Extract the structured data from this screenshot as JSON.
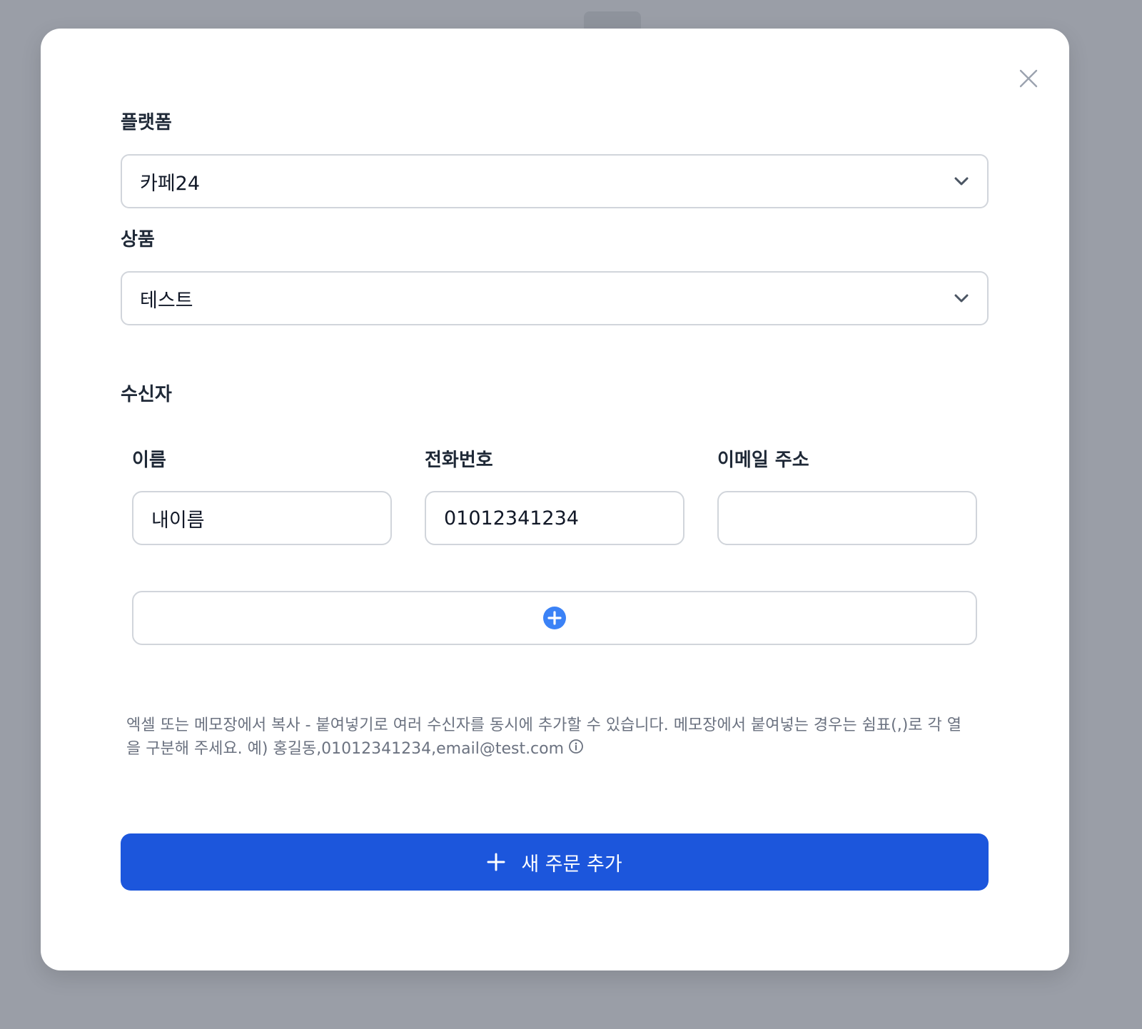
{
  "form": {
    "platform": {
      "label": "플랫폼",
      "value": "카페24"
    },
    "product": {
      "label": "상품",
      "value": "테스트"
    },
    "recipients": {
      "section_title": "수신자",
      "columns": {
        "name": "이름",
        "phone": "전화번호",
        "email": "이메일 주소"
      },
      "row": {
        "name": "내이름",
        "phone": "01012341234",
        "email": ""
      }
    },
    "help_text": "엑셀 또는 메모장에서 복사 - 붙여넣기로 여러 수신자를 동시에 추가할 수 있습니다. 메모장에서 붙여넣는 경우는 쉼표(,)로 각 열을 구분해 주세요. 예) 홍길동,01012341234,email@test.com",
    "submit_label": "새 주문 추가"
  },
  "colors": {
    "primary": "#1c56dc",
    "add_icon": "#3b82f6",
    "border": "#d1d5db",
    "backdrop": "#9a9ea7"
  },
  "icons": {
    "close": "close-icon",
    "chevron": "chevron-down-icon",
    "add_row": "plus-circle-icon",
    "info": "info-icon",
    "submit": "plus-icon"
  }
}
